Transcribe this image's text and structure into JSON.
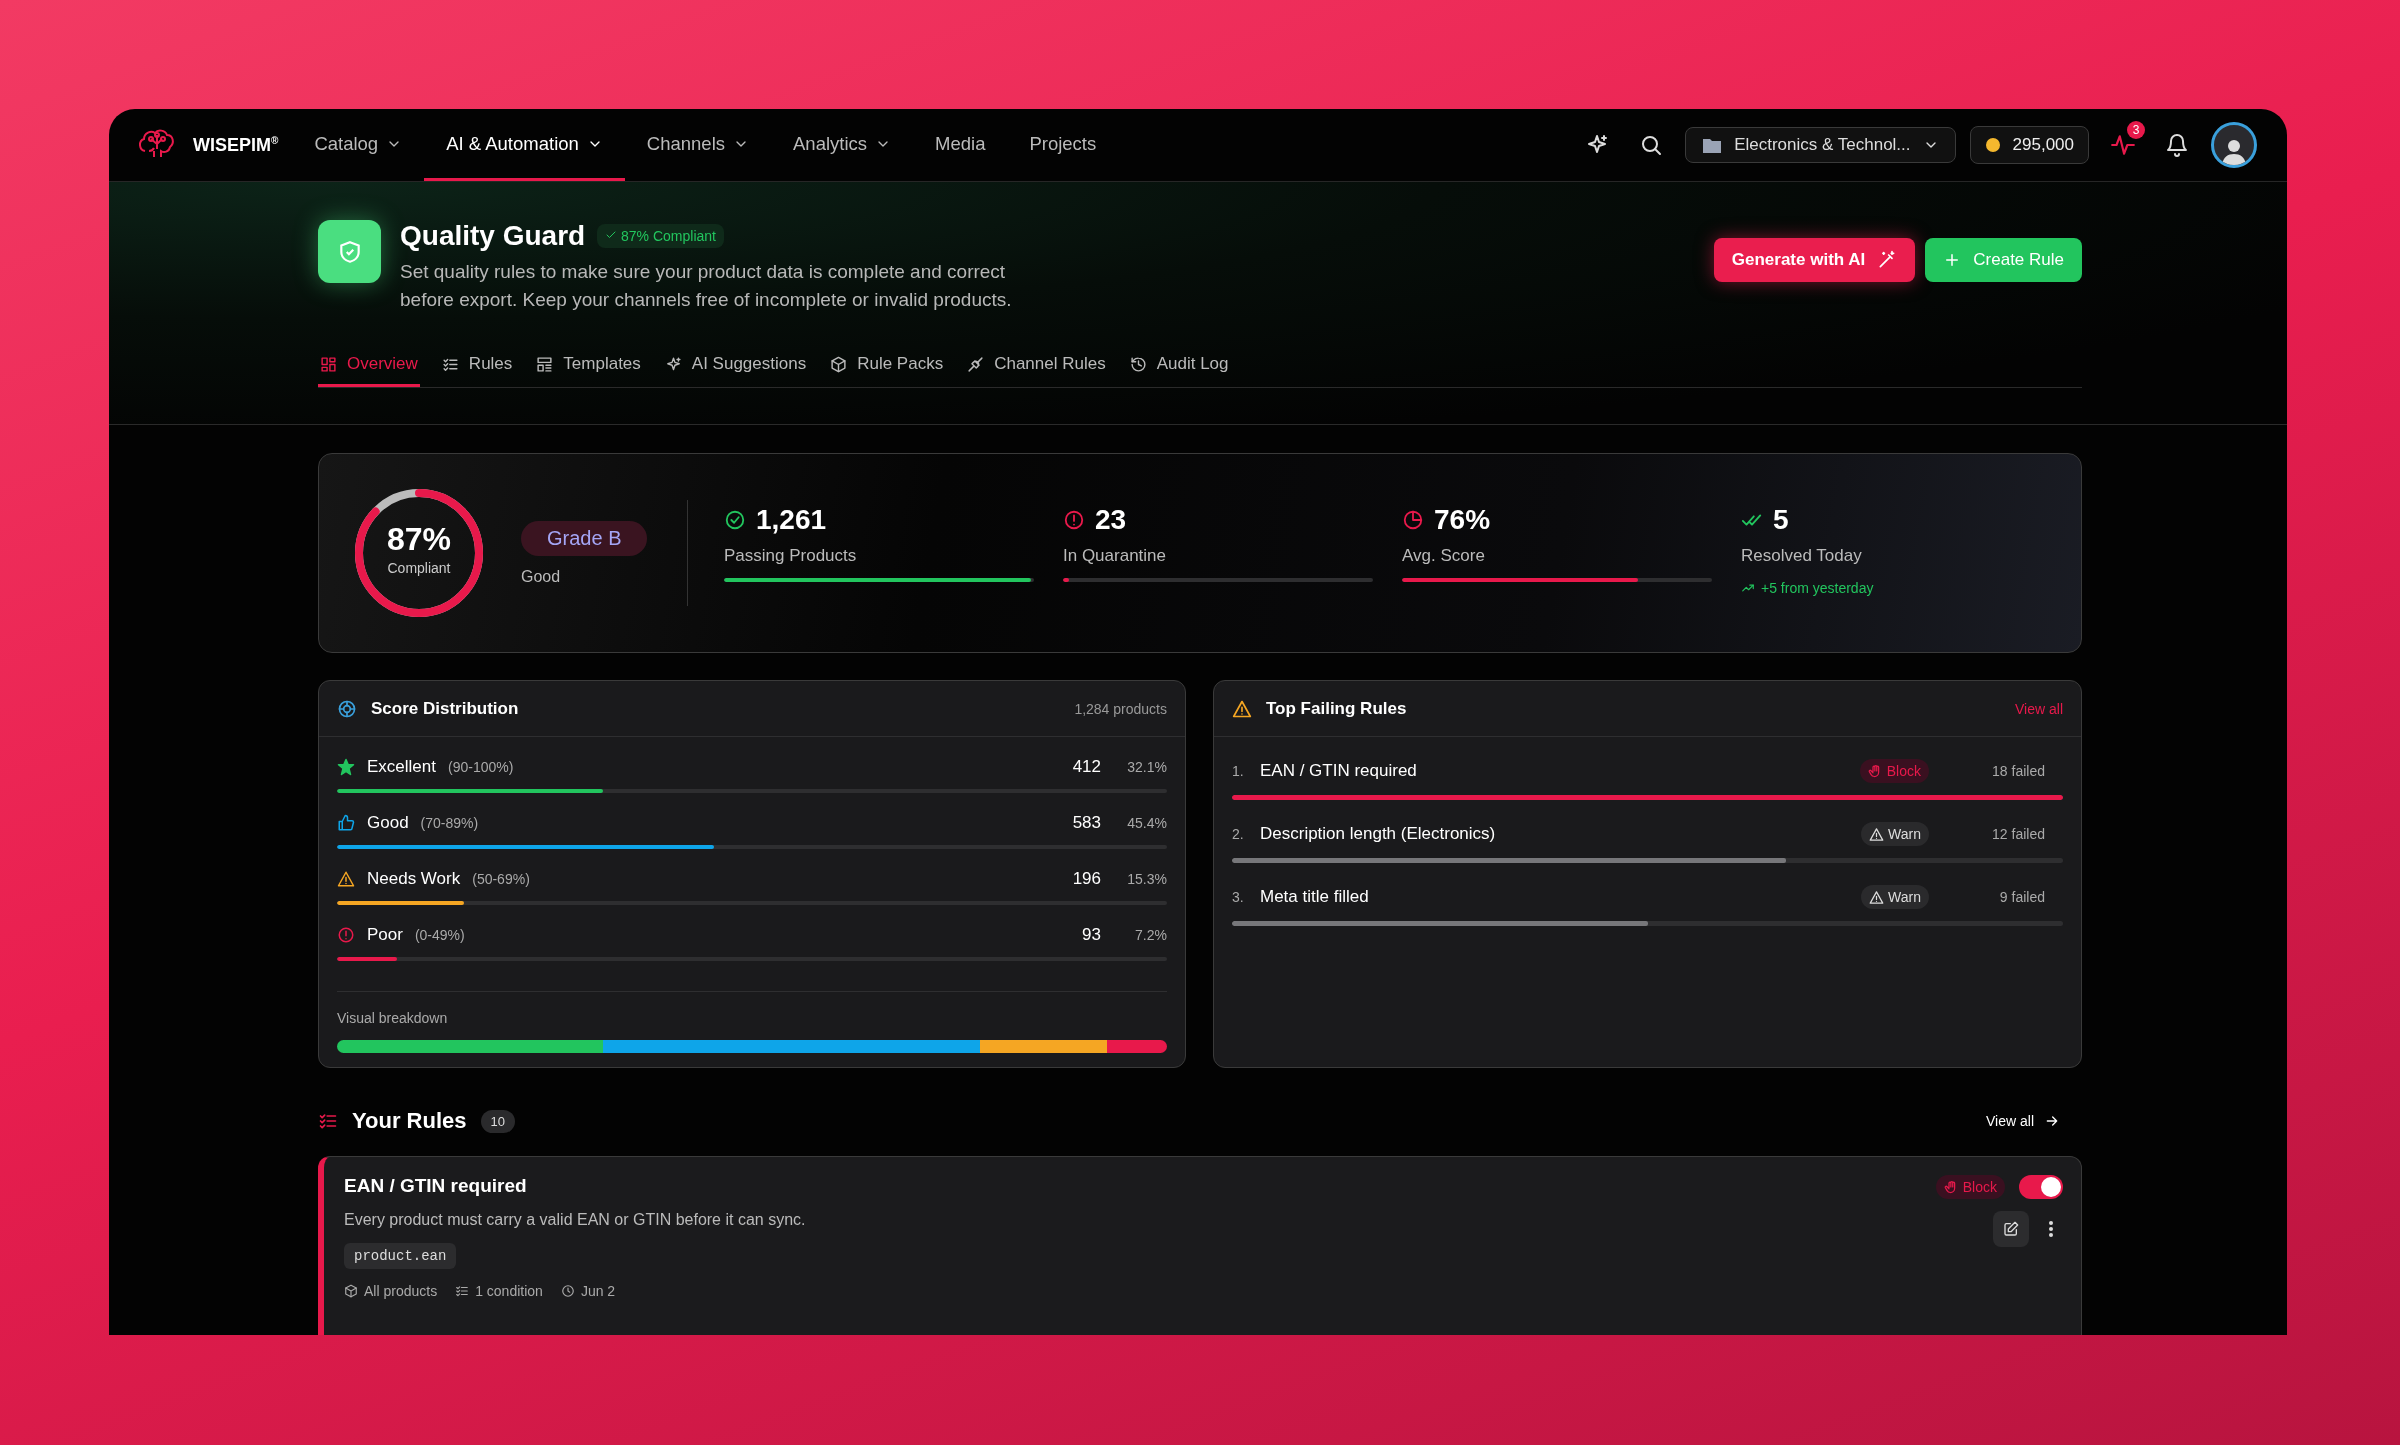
{
  "nav": {
    "brand": "WISEPIM$^{®}$",
    "items": [
      {
        "label": "Catalog",
        "selected": false,
        "dropdown": true
      },
      {
        "label": "AI & Automation",
        "selected": true,
        "dropdown": true
      },
      {
        "label": "Channels",
        "selected": false,
        "dropdown": true
      },
      {
        "label": "Analytics",
        "selected": false,
        "dropdown": true
      },
      {
        "label": "Media",
        "selected": false,
        "dropdown": false
      },
      {
        "label": "Projects",
        "selected": false,
        "dropdown": false
      }
    ],
    "workspace": "Electronics & Technol...",
    "credits": "295,000",
    "activity_badge": "3"
  },
  "header": {
    "title": "Quality Guard",
    "badge": "87% Compliant",
    "description": "Set quality rules to make sure your product data is complete and correct before export. Keep your channels free of incomplete or invalid products.",
    "buttons": [
      {
        "label": "Generate with AI",
        "kind": "ai"
      },
      {
        "label": "Create Rule",
        "kind": "create"
      }
    ]
  },
  "tabs": [
    {
      "label": "Overview",
      "selected": true
    },
    {
      "label": "Rules",
      "selected": false
    },
    {
      "label": "Templates",
      "selected": false
    },
    {
      "label": "AI Suggestions",
      "selected": false
    },
    {
      "label": "Rule Packs",
      "selected": false
    },
    {
      "label": "Channel Rules",
      "selected": false
    },
    {
      "label": "Audit Log",
      "selected": false
    }
  ],
  "summary": {
    "gauge": {
      "level": 0.87,
      "value": "87%",
      "label": "Compliant"
    },
    "grade": "Grade B",
    "grade_label": "Good",
    "stats": [
      {
        "kind": "bar",
        "value": "1,261",
        "label": "Passing Products",
        "level": 0.99,
        "color": "#22c55e"
      },
      {
        "kind": "bar",
        "value": "23",
        "label": "In Quarantine",
        "level": 0.02,
        "color": "#e8194b"
      },
      {
        "kind": "bar",
        "value": "76%",
        "label": "Avg. Score",
        "level": 0.76,
        "color": "#e8194b"
      },
      {
        "kind": "trend",
        "value": "5",
        "label": "Resolved Today",
        "note": "+5 from yesterday",
        "color": "#22c55e"
      }
    ]
  },
  "score_distribution": {
    "title": "Score Distribution",
    "total": "1,284 products",
    "rows": [
      {
        "label": "Excellent",
        "range": "(90-100%)",
        "count": "412",
        "percent": "32.1%",
        "level": 0.321,
        "color": "#22c55e"
      },
      {
        "label": "Good",
        "range": "(70-89%)",
        "count": "583",
        "percent": "45.4%",
        "level": 0.454,
        "color": "#0ea5e9"
      },
      {
        "label": "Needs Work",
        "range": "(50-69%)",
        "count": "196",
        "percent": "15.3%",
        "level": 0.153,
        "color": "#f5a623"
      },
      {
        "label": "Poor",
        "range": "(0-49%)",
        "count": "93",
        "percent": "7.2%",
        "level": 0.072,
        "color": "#e8194b"
      }
    ],
    "breakdown_label": "Visual breakdown"
  },
  "top_failing_rules": {
    "title": "Top Failing Rules",
    "view_all": "View all",
    "rows": [
      {
        "rank": "1.",
        "name": "EAN / GTIN required",
        "kind": "block",
        "severity_label": "Block",
        "failed": "18 failed",
        "level": 1.0
      },
      {
        "rank": "2.",
        "name": "Description length (Electronics)",
        "kind": "warn",
        "severity_label": "Warn",
        "failed": "12 failed",
        "level": 0.667
      },
      {
        "rank": "3.",
        "name": "Meta title filled",
        "kind": "warn",
        "severity_label": "Warn",
        "failed": "9 failed",
        "level": 0.5
      }
    ]
  },
  "your_rules": {
    "title": "Your Rules",
    "count": "10",
    "view_all": "View all",
    "rules": [
      {
        "name": "EAN / GTIN required",
        "kind": "block",
        "severity_label": "Block",
        "on": true,
        "description": "Every product must carry a valid EAN or GTIN before it can sync.",
        "tag": "product.ean",
        "scope": "All products",
        "conditions": "1 condition",
        "date": "Jun 2"
      }
    ]
  }
}
